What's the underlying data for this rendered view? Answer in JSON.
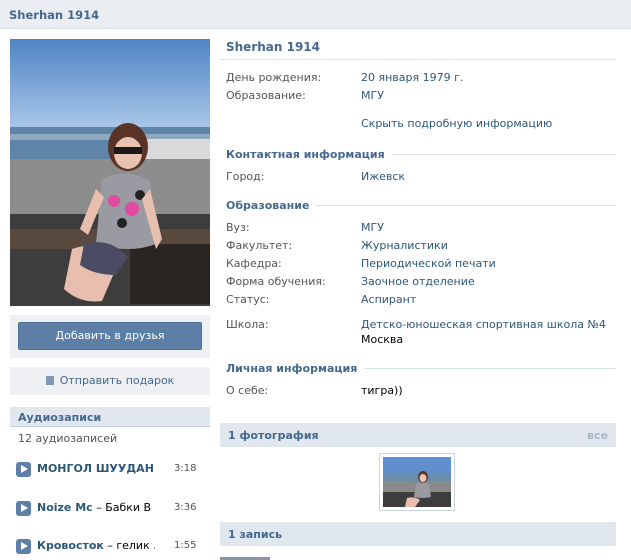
{
  "page": {
    "title": "Sherhan 1914"
  },
  "left": {
    "add_friend_label": "Добавить в друзья",
    "gift_label": "Отправить подарок",
    "audio": {
      "title": "Аудиозаписи",
      "count": "12 аудиозаписей",
      "items": [
        {
          "artist": "МОНГОЛ ШУУДАН",
          "title": "",
          "display": "МОНГОЛ ШУУДАН...",
          "duration": "3:18"
        },
        {
          "artist": "Noize Mc",
          "title": " – Бабки В ...",
          "duration": "3:36"
        },
        {
          "artist": "Кровосток",
          "title": " – гелик ...",
          "duration": "1:55"
        }
      ]
    }
  },
  "profile": {
    "name": "Sherhan 1914",
    "summary": {
      "birthday_label": "День рождения:",
      "birthday_value": "20 января 1979 г.",
      "education_label": "Образование:",
      "education_value": "МГУ",
      "hide_link": "Скрыть подробную информацию"
    },
    "contacts": {
      "header": "Контактная информация",
      "city_label": "Город:",
      "city_value": "Ижевск"
    },
    "education": {
      "header": "Образование",
      "rows": [
        {
          "label": "Вуз:",
          "value": "МГУ"
        },
        {
          "label": "Факультет:",
          "value": "Журналистики"
        },
        {
          "label": "Кафедра:",
          "value": "Периодической печати"
        },
        {
          "label": "Форма обучения:",
          "value": "Заочное отделение"
        },
        {
          "label": "Статус:",
          "value": "Аспирант"
        }
      ],
      "school_label": "Школа:",
      "school_value": "Детско-юношеская спортивная школа №4",
      "school_city": "Москва"
    },
    "personal": {
      "header": "Личная информация",
      "about_label": "О себе:",
      "about_value": "тигра))"
    },
    "photos": {
      "header": "1 фотография",
      "all_link": "все"
    },
    "wall": {
      "header": "1 запись"
    }
  },
  "colors": {
    "accent": "#45688e",
    "link": "#2b587a",
    "bar": "#e1e7ee",
    "button": "#5d7fa5"
  }
}
